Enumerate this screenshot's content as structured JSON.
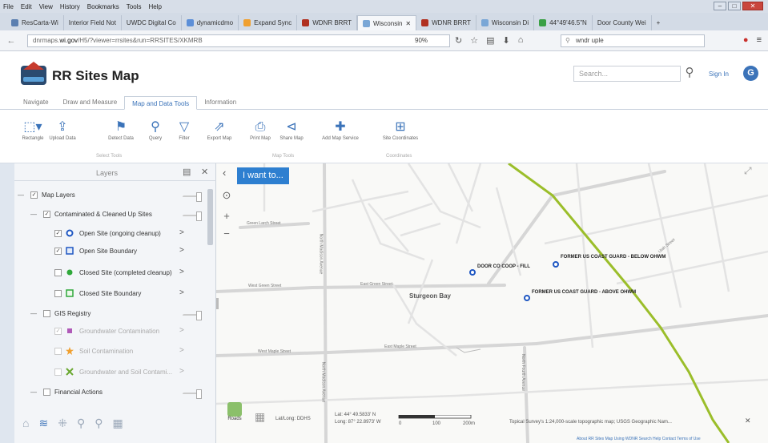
{
  "browser": {
    "menu": [
      "File",
      "Edit",
      "View",
      "History",
      "Bookmarks",
      "Tools",
      "Help"
    ],
    "tabs": [
      {
        "label": "ResCarta-Wi",
        "active": false
      },
      {
        "label": "Interior Field Not",
        "active": false
      },
      {
        "label": "UWDC Digital Co",
        "active": false
      },
      {
        "label": "dynamicdmo",
        "active": false
      },
      {
        "label": "Expand Sync",
        "active": false
      },
      {
        "label": "WDNR BRRT",
        "active": false
      },
      {
        "label": "Wisconsin",
        "active": true
      },
      {
        "label": "WDNR BRRT",
        "active": false
      },
      {
        "label": "Wisconsin Di",
        "active": false
      },
      {
        "label": "44°49'46.5\"N",
        "active": false
      },
      {
        "label": "Door County Wei",
        "active": false
      }
    ],
    "url_prefix": "dnrmaps.",
    "url_domain": "wi.gov",
    "url_rest": "/H5/?viewer=rrsites&run=RRSITES/XKMRB",
    "zoom": "90%",
    "search_value": "wndr uple"
  },
  "app": {
    "title": "RR Sites Map",
    "search_placeholder": "Search...",
    "sign_in": "Sign In",
    "ribbon_tabs": [
      {
        "label": "Navigate",
        "active": false
      },
      {
        "label": "Draw and Measure",
        "active": false
      },
      {
        "label": "Map and Data Tools",
        "active": true
      },
      {
        "label": "Information",
        "active": false
      }
    ],
    "tools": [
      "Rectangle",
      "Upload Data",
      "Detect Data",
      "Query",
      "Filter",
      "Export Map",
      "Print Map",
      "Share Map",
      "Add Map Service",
      "Site Coordinates"
    ],
    "groups": [
      "Select Tools",
      "Map Tools",
      "Coordinates"
    ]
  },
  "layers": {
    "title": "Layers",
    "rows": [
      {
        "label": "Map Layers",
        "level": 0,
        "checked": true,
        "dim": false,
        "symbol": ""
      },
      {
        "label": "Contaminated & Cleaned Up Sites",
        "level": 1,
        "checked": true,
        "dim": false,
        "symbol": ""
      },
      {
        "label": "Open Site (ongoing cleanup)",
        "level": 2,
        "checked": true,
        "dim": false,
        "symbol": "blue-dot"
      },
      {
        "label": "Open Site Boundary",
        "level": 2,
        "checked": true,
        "dim": false,
        "symbol": "blue-square"
      },
      {
        "label": "Closed Site (completed cleanup)",
        "level": 2,
        "checked": false,
        "dim": false,
        "symbol": "green-dot"
      },
      {
        "label": "Closed Site Boundary",
        "level": 2,
        "checked": false,
        "dim": false,
        "symbol": "green-square"
      },
      {
        "label": "GIS Registry",
        "level": 1,
        "checked": false,
        "dim": false,
        "symbol": ""
      },
      {
        "label": "Groundwater Contamination",
        "level": 2,
        "checked": true,
        "dim": true,
        "symbol": "purple-square"
      },
      {
        "label": "Soil Contamination",
        "level": 2,
        "checked": false,
        "dim": true,
        "symbol": "orange-star"
      },
      {
        "label": "Groundwater and Soil Contami...",
        "level": 2,
        "checked": false,
        "dim": true,
        "symbol": "green-x"
      },
      {
        "label": "Financial Actions",
        "level": 1,
        "checked": false,
        "dim": false,
        "symbol": ""
      }
    ]
  },
  "map": {
    "i_want_to": "I want to...",
    "city": "Sturgeon Bay",
    "sites": [
      {
        "label": "DOOR CO COOP - FILL"
      },
      {
        "label": "FORMER US COAST GUARD - BELOW OHWM"
      },
      {
        "label": "FORMER US COAST GUARD - ABOVE OHWM"
      }
    ],
    "streets": [
      "Green Larch Street",
      "West Green Street",
      "East Green Street",
      "West Maple Street",
      "East Maple Street",
      "North Madison Avenue",
      "North Madison Avenue",
      "North Fourth Avenue",
      "Utah Street"
    ],
    "basemap_label": "Roads",
    "coord_mode": "Lat/Long: DDHS",
    "lat": "Lat:  44° 49.5833' N",
    "long": "Long: 87° 22.8973' W",
    "scale_ticks": [
      "0",
      "100",
      "200m"
    ],
    "attribution": "Topical Survey's 1:24,000-scale topographic map; USGS Geographic Nam...",
    "footer_links": "About RR Sites Map  Using WDNR  Search Help  Contact  Terms of Use"
  },
  "colors": {
    "accent": "#2e7fd0",
    "open_site": "#1f57c2",
    "closed_site": "#2fa83a",
    "boundary": "#9bbe2a"
  }
}
